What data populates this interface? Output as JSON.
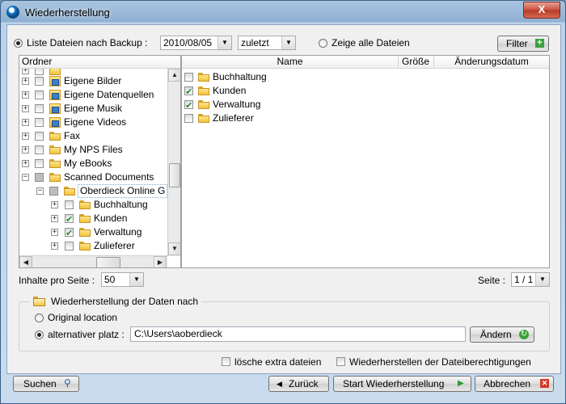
{
  "window": {
    "title": "Wiederherstellung",
    "close_label": "X"
  },
  "toolbar": {
    "list_backup_label": "Liste Dateien nach Backup :",
    "backup_date": "2010/08/05",
    "backup_version": "zuletzt",
    "show_all_label": "Zeige alle Dateien",
    "filter_label": "Filter"
  },
  "tree": {
    "header": "Ordner",
    "items": [
      {
        "label": "Eigene Bilder"
      },
      {
        "label": "Eigene Datenquellen"
      },
      {
        "label": "Eigene Musik"
      },
      {
        "label": "Eigene Videos"
      },
      {
        "label": "Fax"
      },
      {
        "label": "My NPS Files"
      },
      {
        "label": "My eBooks"
      },
      {
        "label": "Scanned Documents"
      },
      {
        "label": "Oberdieck Online G"
      },
      {
        "label": "Buchhaltung"
      },
      {
        "label": "Kunden"
      },
      {
        "label": "Verwaltung"
      },
      {
        "label": "Zulieferer"
      }
    ]
  },
  "files": {
    "columns": {
      "name": "Name",
      "size": "Größe",
      "modified": "Änderungsdatum"
    },
    "rows": [
      {
        "name": "Buchhaltung"
      },
      {
        "name": "Kunden"
      },
      {
        "name": "Verwaltung"
      },
      {
        "name": "Zulieferer"
      }
    ]
  },
  "paging": {
    "per_page_label": "Inhalte pro Seite :",
    "per_page_value": "50",
    "page_label": "Seite :",
    "page_value": "1 / 1"
  },
  "restore": {
    "legend": "Wiederherstellung der Daten nach",
    "original_label": "Original location",
    "alternative_label": "alternativer platz :",
    "path_value": "C:\\Users\\aoberdieck",
    "change_label": "Ändern"
  },
  "options": {
    "delete_extra_label": "lösche extra dateien",
    "restore_permissions_label": "Wiederherstellen der Dateiberechtigungen"
  },
  "footer": {
    "search_label": "Suchen",
    "back_label": "Zurück",
    "start_label": "Start Wiederherstellung",
    "cancel_label": "Abbrechen"
  }
}
